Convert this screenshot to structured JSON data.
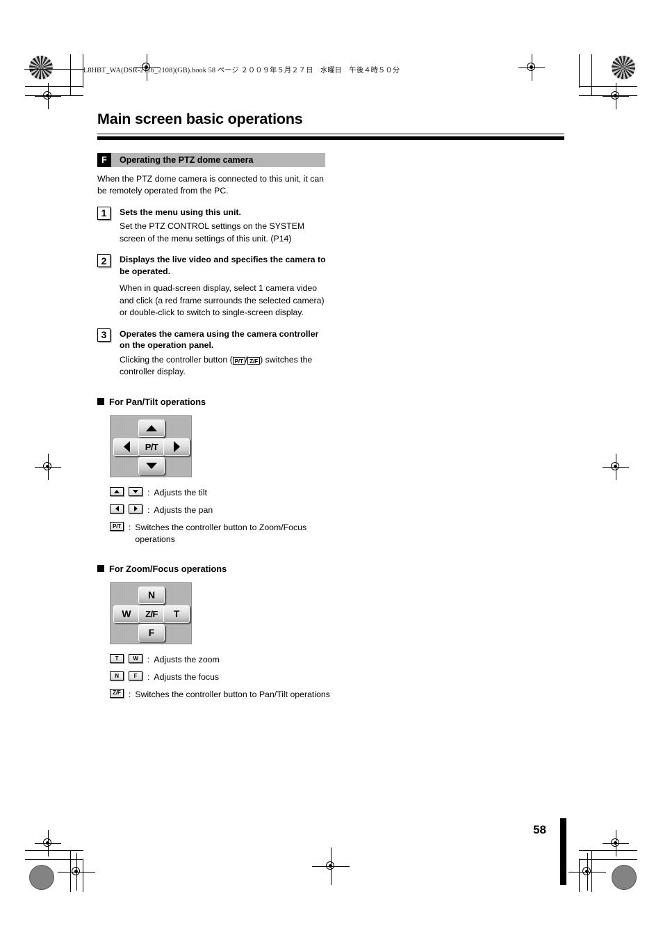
{
  "document": {
    "header_text": "L8HBT_WA(DSR-2116_2108)(GB).book   58 ページ   ２００９年５月２７日　水曜日　午後４時５０分",
    "page_number": "58",
    "title": "Main screen basic operations"
  },
  "section": {
    "letter": "F",
    "label": "Operating the PTZ dome camera",
    "intro": "When the PTZ dome camera is connected to this unit, it can be remotely operated from the PC."
  },
  "steps": [
    {
      "number": "1",
      "title": "Sets the menu using this unit.",
      "text": "Set the PTZ CONTROL settings on the SYSTEM screen of the menu settings of this unit. (P14)"
    },
    {
      "number": "2",
      "title": "Displays the live video and specifies the camera to be operated.",
      "text": "When in quad-screen display, select 1 camera video and click (a red frame surrounds the selected camera) or double-click to switch to single-screen display."
    },
    {
      "number": "3",
      "title": "Operates the camera using the camera controller on the operation panel.",
      "text_before": "Clicking the controller button (",
      "key1": "P/T",
      "text_middle": "/",
      "key2": "Z/F",
      "text_after": ") switches the controller display."
    }
  ],
  "pantilt": {
    "heading": "For Pan/Tilt operations",
    "panel": {
      "top": "up-arrow",
      "left": "left-arrow",
      "center": "P/T",
      "right": "right-arrow",
      "bottom": "down-arrow"
    },
    "legend": [
      {
        "keys": [
          "up-arrow",
          "down-arrow"
        ],
        "colon": ":",
        "desc": "Adjusts the tilt"
      },
      {
        "keys": [
          "left-arrow",
          "right-arrow"
        ],
        "colon": ":",
        "desc": "Adjusts the pan"
      },
      {
        "keys": [
          "P/T"
        ],
        "colon": ":",
        "desc": "Switches the controller button to Zoom/Focus operations"
      }
    ]
  },
  "zoomfocus": {
    "heading": "For Zoom/Focus operations",
    "panel": {
      "top": "N",
      "left": "W",
      "center": "Z/F",
      "right": "T",
      "bottom": "F"
    },
    "legend": [
      {
        "keys": [
          "T",
          "W"
        ],
        "colon": ":",
        "desc": "Adjusts the zoom"
      },
      {
        "keys": [
          "N",
          "F"
        ],
        "colon": ":",
        "desc": "Adjusts the focus"
      },
      {
        "keys": [
          "Z/F"
        ],
        "colon": ":",
        "desc": "Switches the controller button to Pan/Tilt operations"
      }
    ]
  }
}
